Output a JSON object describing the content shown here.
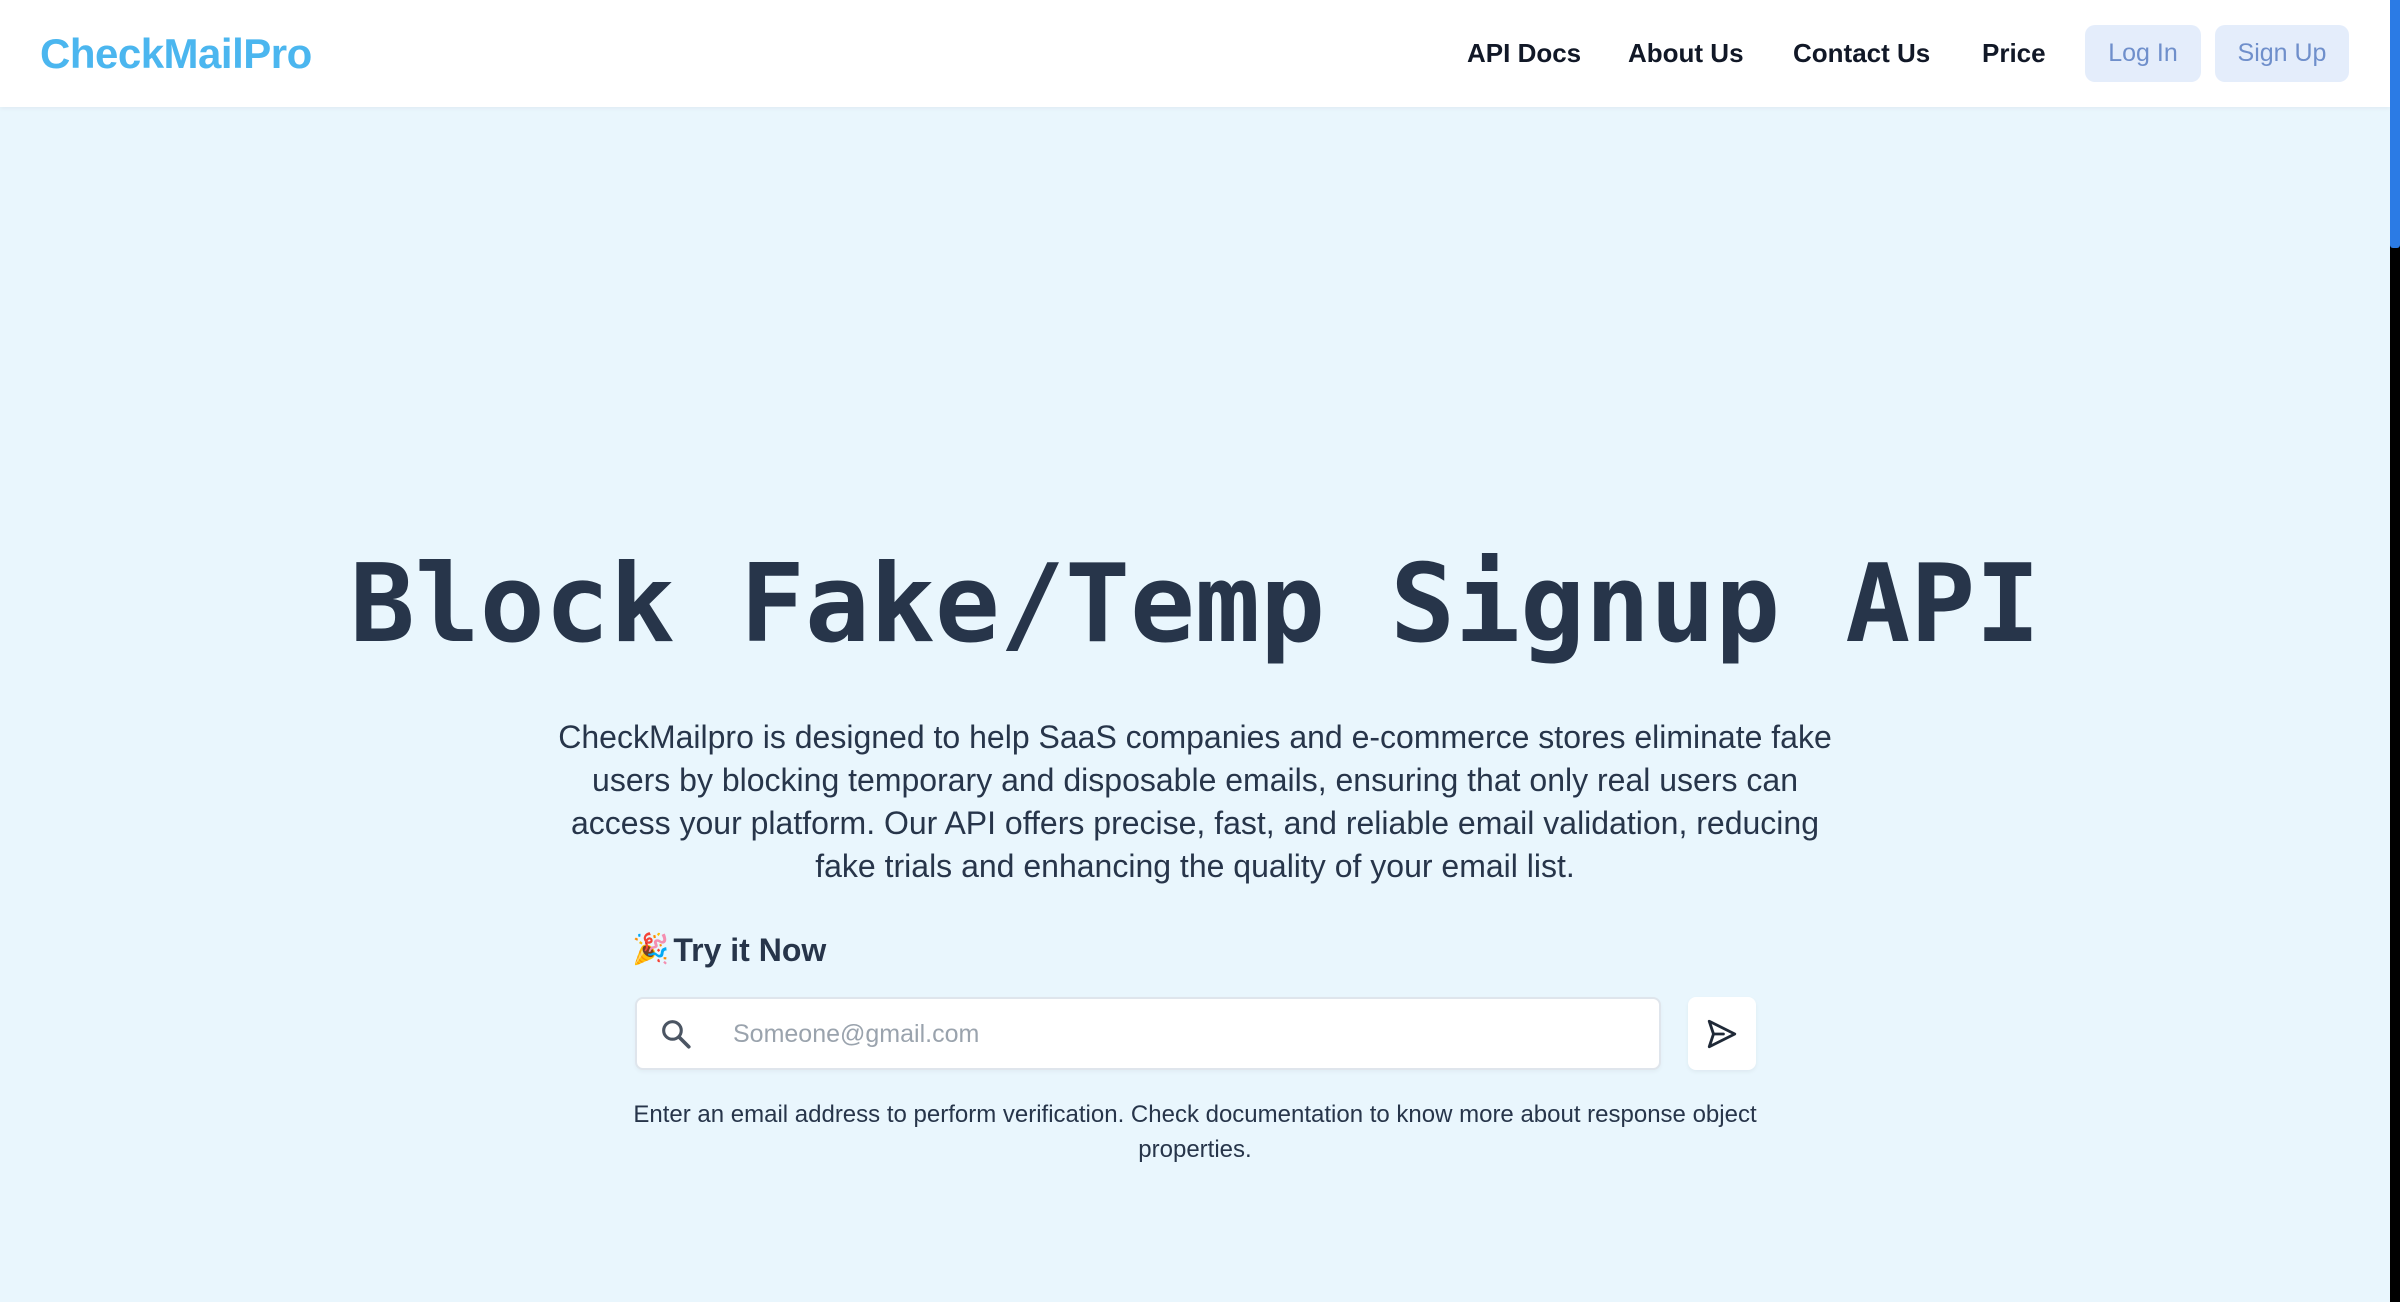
{
  "header": {
    "logo": "CheckMailPro",
    "nav": [
      {
        "label": "API Docs"
      },
      {
        "label": "About Us"
      },
      {
        "label": "Contact Us"
      },
      {
        "label": "Price"
      }
    ],
    "login_label": "Log In",
    "signup_label": "Sign Up"
  },
  "hero": {
    "title": "Block Fake/Temp Signup API",
    "description": "CheckMailpro is designed to help SaaS companies and e-commerce stores eliminate fake users by blocking temporary and disposable emails, ensuring that only real users can access your platform. Our API offers precise, fast, and reliable email validation, reducing fake trials and enhancing the quality of your email list."
  },
  "try_it": {
    "icon": "party-popper-icon",
    "label": "Try it Now",
    "input_placeholder": "Someone@gmail.com",
    "input_value": "",
    "helper_text": "Enter an email address to perform verification. Check documentation to know more about response object properties."
  },
  "colors": {
    "brand": "#4bb6ef",
    "page_background": "#e9f6fd",
    "heading": "#27354a",
    "auth_button_bg": "#e4edfb",
    "auth_button_text": "#6f8fcb",
    "scrollbar_thumb": "#2b7be5"
  }
}
